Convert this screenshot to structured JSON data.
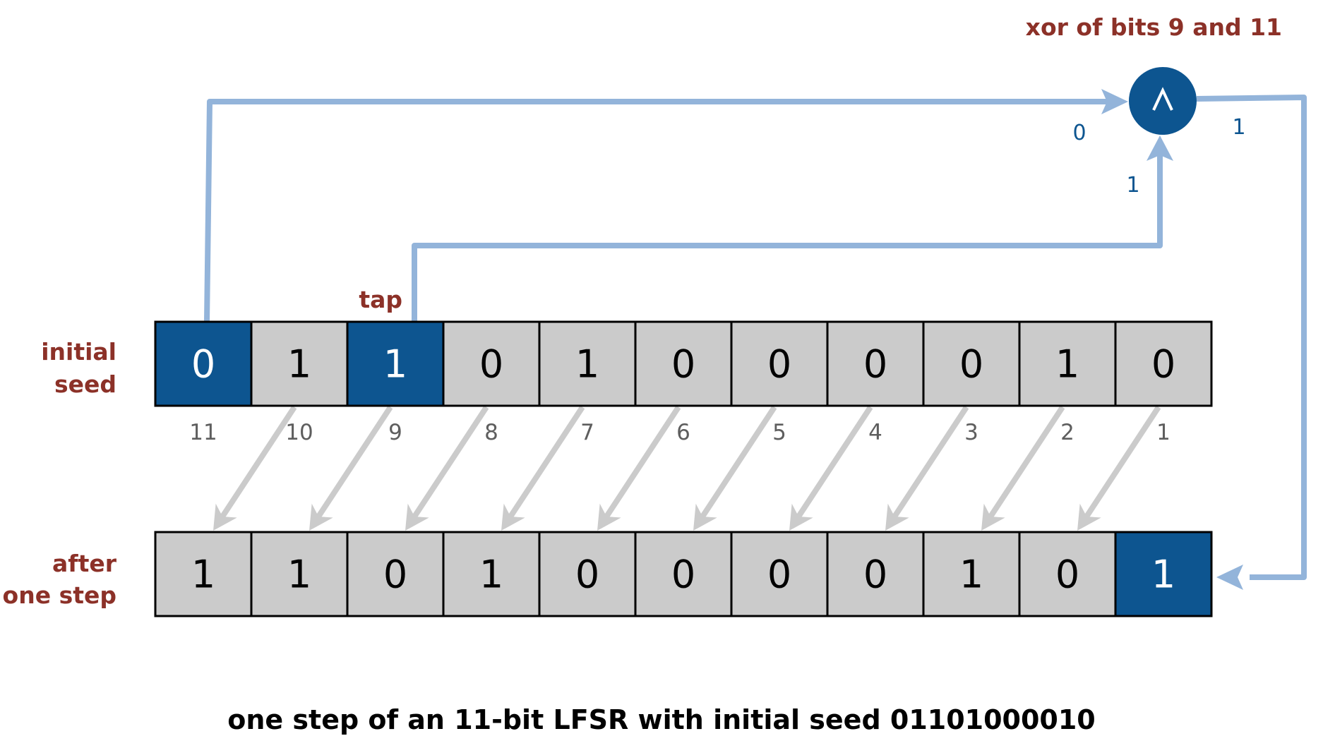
{
  "colors": {
    "highlight_fill": "#0d5590",
    "cell_fill": "#cbcbcb",
    "cell_border": "#000000",
    "wire": "#93b4da",
    "shift_arrow": "#cbcbcb",
    "label_red": "#8c3128",
    "label_blue": "#0d5590",
    "index_gray": "#5e5e5e"
  },
  "xor_title": "xor of bits 9 and 11",
  "xor_symbol": "^",
  "tap_label": "tap",
  "wire_values": {
    "bit11_to_xor": "0",
    "bit9_to_xor": "1",
    "xor_output": "1"
  },
  "rows": {
    "initial": {
      "label_line1": "initial",
      "label_line2": "seed",
      "bits": [
        "0",
        "1",
        "1",
        "0",
        "1",
        "0",
        "0",
        "0",
        "0",
        "1",
        "0"
      ],
      "highlighted": [
        true,
        false,
        true,
        false,
        false,
        false,
        false,
        false,
        false,
        false,
        false
      ]
    },
    "after": {
      "label_line1": "after",
      "label_line2": "one step",
      "bits": [
        "1",
        "1",
        "0",
        "1",
        "0",
        "0",
        "0",
        "0",
        "1",
        "0",
        "1"
      ],
      "highlighted": [
        false,
        false,
        false,
        false,
        false,
        false,
        false,
        false,
        false,
        false,
        true
      ]
    }
  },
  "bit_indices": [
    "11",
    "10",
    "9",
    "8",
    "7",
    "6",
    "5",
    "4",
    "3",
    "2",
    "1"
  ],
  "caption": "one step of an 11-bit LFSR with initial seed 01101000010"
}
